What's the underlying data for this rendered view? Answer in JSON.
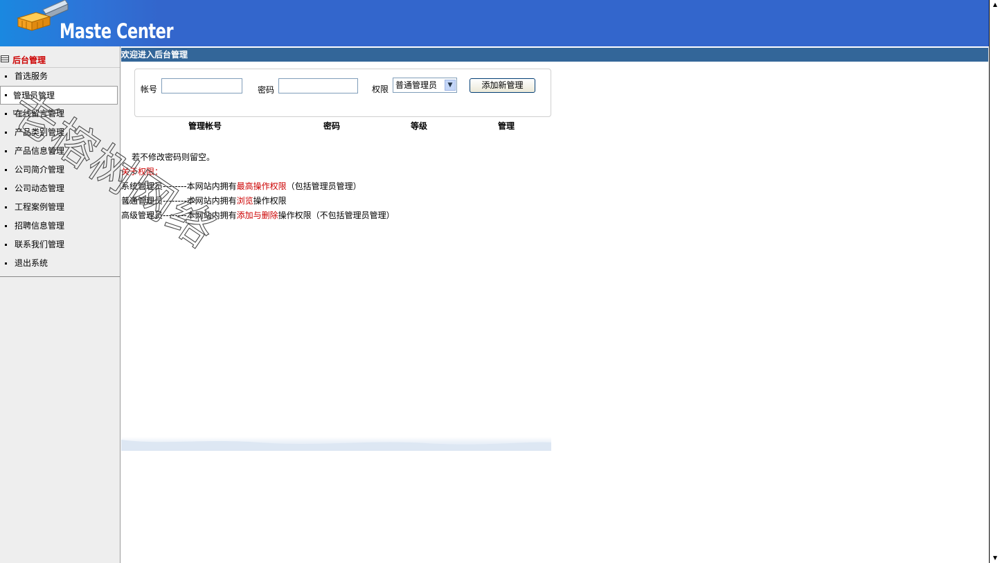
{
  "header": {
    "logo_text": "Maste Center",
    "logo_icon": "cargo-box-icon"
  },
  "sidebar": {
    "title": "后台管理",
    "title_icon": "list-icon",
    "items": [
      {
        "label": "首选服务"
      },
      {
        "label": "管理员管理",
        "active": true
      },
      {
        "label": "在线留言管理"
      },
      {
        "label": "产品类别管理"
      },
      {
        "label": "产品信息管理"
      },
      {
        "label": "公司简介管理"
      },
      {
        "label": "公司动态管理"
      },
      {
        "label": "工程案例管理"
      },
      {
        "label": "招聘信息管理"
      },
      {
        "label": "联系我们管理"
      },
      {
        "label": "退出系统"
      }
    ]
  },
  "main": {
    "title": "欢迎进入后台管理",
    "form": {
      "account_label": "帐号",
      "account_value": "",
      "password_label": "密码",
      "password_value": "",
      "role_label": "权限",
      "role_selected": "普通管理员",
      "add_button": "添加新管理"
    },
    "table_headers": [
      "管理帐号",
      "密码",
      "等级",
      "管理"
    ],
    "notes": {
      "tip": "若不修改密码则留空。",
      "about": "关于权限：",
      "system_admin_prefix": "系统管理员--------本网站内拥有",
      "system_admin_highlight": "最高操作权限",
      "system_admin_suffix": "（包括管理员管理）",
      "normal_admin_prefix": "普通管理员--------本网站内拥有",
      "normal_admin_highlight": "浏览",
      "normal_admin_suffix": "操作权限",
      "senior_admin_prefix": "高级管理员--------本网站内拥有",
      "senior_admin_highlight": "添加与删除",
      "senior_admin_suffix": "操作权限（不包括管理员管理）"
    }
  },
  "watermark": {
    "text": "老榕树网络"
  },
  "colors": {
    "header_bg": "#3366cc",
    "title_bar_bg": "#336699",
    "highlight_red": "#cc0000",
    "sidebar_bg": "#eeeeee"
  }
}
